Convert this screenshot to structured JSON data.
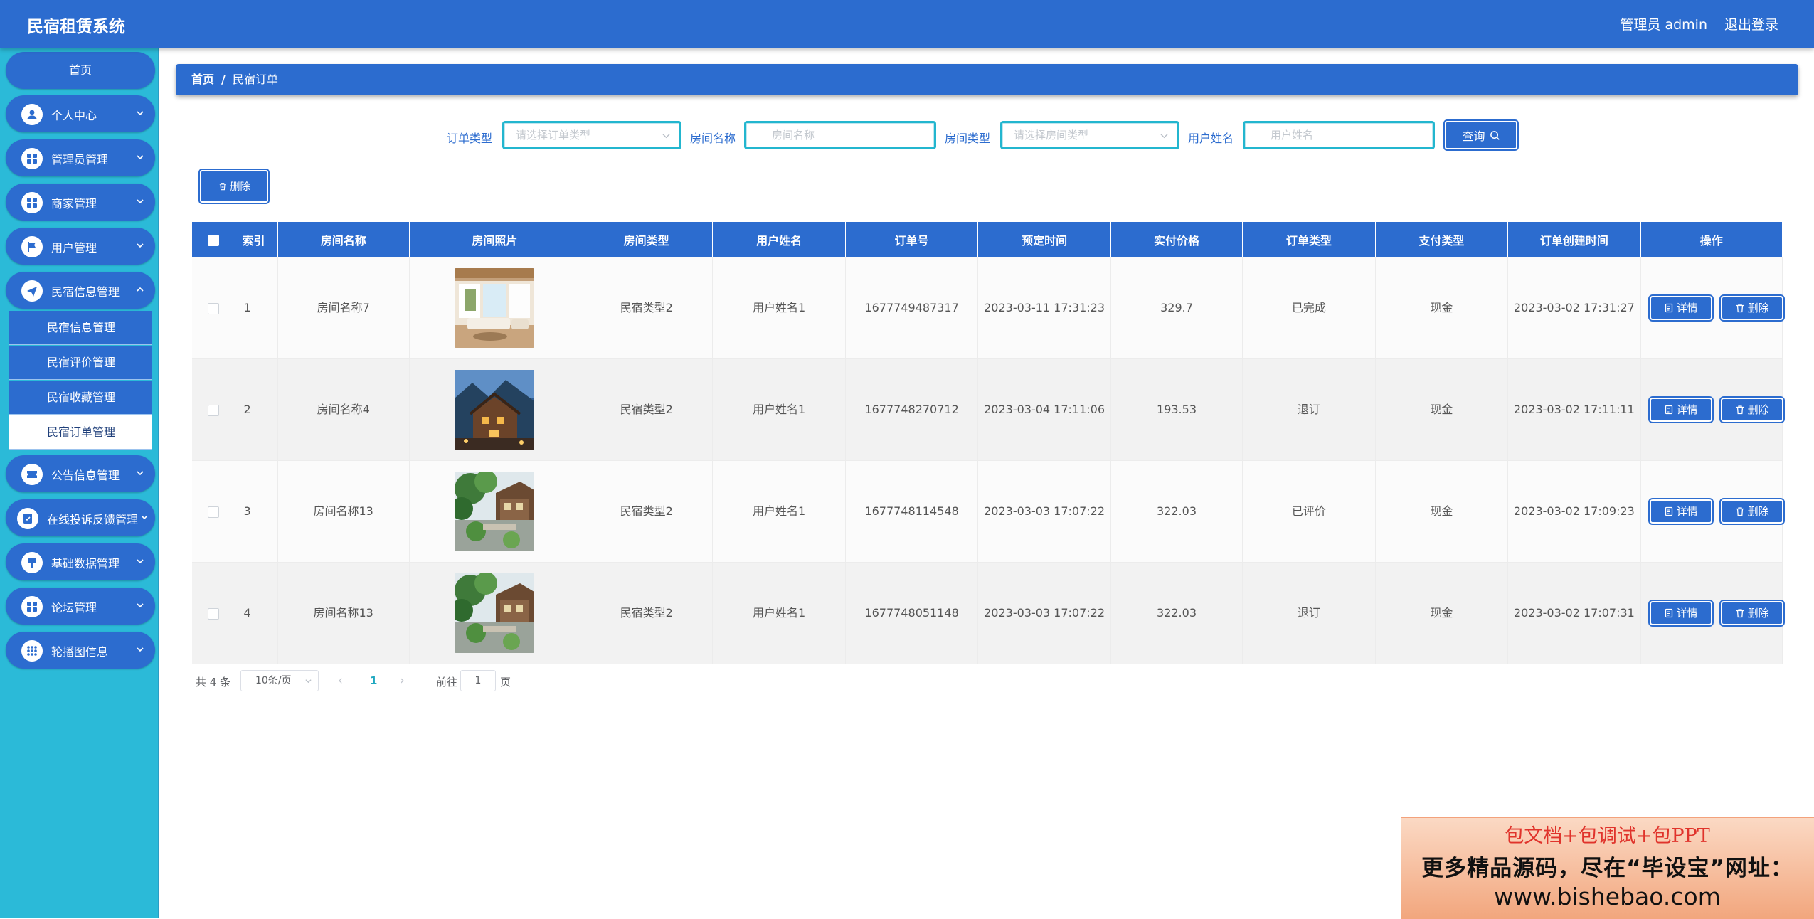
{
  "app": {
    "title": "民宿租赁系统",
    "admin_label": "管理员 admin",
    "logout_label": "退出登录"
  },
  "sidebar": {
    "home": "首页",
    "items": [
      {
        "label": "个人中心",
        "icon": "user-icon"
      },
      {
        "label": "管理员管理",
        "icon": "grid-icon"
      },
      {
        "label": "商家管理",
        "icon": "grid-icon"
      },
      {
        "label": "用户管理",
        "icon": "flag-icon"
      },
      {
        "label": "民宿信息管理",
        "icon": "send-icon",
        "expanded": true
      },
      {
        "label": "公告信息管理",
        "icon": "ticket-icon"
      },
      {
        "label": "在线投诉反馈管理",
        "icon": "checklist-icon"
      },
      {
        "label": "基础数据管理",
        "icon": "sign-icon"
      },
      {
        "label": "论坛管理",
        "icon": "grid-icon"
      },
      {
        "label": "轮播图信息",
        "icon": "dots-grid-icon"
      }
    ],
    "subitems": [
      "民宿信息管理",
      "民宿评价管理",
      "民宿收藏管理",
      "民宿订单管理"
    ],
    "active_subitem": "民宿订单管理",
    "colors": {
      "sidebar_bg": "#2bbad8",
      "item_bg": "#2c6ccf"
    }
  },
  "breadcrumb": {
    "home": "首页",
    "sep": "/",
    "current": "民宿订单"
  },
  "search": {
    "order_type_label": "订单类型",
    "order_type_placeholder": "请选择订单类型",
    "room_name_label": "房间名称",
    "room_name_placeholder": "房间名称",
    "room_type_label": "房间类型",
    "room_type_placeholder": "请选择房间类型",
    "user_name_label": "用户姓名",
    "user_name_placeholder": "用户姓名",
    "query_label": "查询"
  },
  "toolbar": {
    "delete_label": "删除"
  },
  "table": {
    "headers": [
      "索引",
      "房间名称",
      "房间照片",
      "房间类型",
      "用户姓名",
      "订单号",
      "预定时间",
      "实付价格",
      "订单类型",
      "支付类型",
      "订单创建时间",
      "操作"
    ],
    "rows": [
      {
        "index": "1",
        "room_name": "房间名称7",
        "photo": "bright-living-room-photo",
        "room_type": "民宿类型2",
        "user_name": "用户姓名1",
        "order_no": "1677749487317",
        "booking_time": "2023-03-11 17:31:23",
        "price": "329.7",
        "order_type": "已完成",
        "pay_type": "现金",
        "created_at": "2023-03-02 17:31:27"
      },
      {
        "index": "2",
        "room_name": "房间名称4",
        "photo": "mountain-lodge-dusk-photo",
        "room_type": "民宿类型2",
        "user_name": "用户姓名1",
        "order_no": "1677748270712",
        "booking_time": "2023-03-04 17:11:06",
        "price": "193.53",
        "order_type": "退订",
        "pay_type": "现金",
        "created_at": "2023-03-02 17:11:11"
      },
      {
        "index": "3",
        "room_name": "房间名称13",
        "photo": "garden-cabin-photo",
        "room_type": "民宿类型2",
        "user_name": "用户姓名1",
        "order_no": "1677748114548",
        "booking_time": "2023-03-03 17:07:22",
        "price": "322.03",
        "order_type": "已评价",
        "pay_type": "现金",
        "created_at": "2023-03-02 17:09:23"
      },
      {
        "index": "4",
        "room_name": "房间名称13",
        "photo": "garden-cabin-photo",
        "room_type": "民宿类型2",
        "user_name": "用户姓名1",
        "order_no": "1677748051148",
        "booking_time": "2023-03-03 17:07:22",
        "price": "322.03",
        "order_type": "退订",
        "pay_type": "现金",
        "created_at": "2023-03-02 17:07:31"
      }
    ],
    "detail_label": "详情",
    "delete_label": "删除"
  },
  "pagination": {
    "total": "共 4 条",
    "page_size": "10条/页",
    "current_page": "1",
    "goto_prefix": "前往",
    "goto_value": "1",
    "goto_suffix": "页"
  },
  "watermark": {
    "line1": "包文档+包调试+包PPT",
    "line2": "更多精品源码，尽在“毕设宝”网址：",
    "line3": "www.bishebao.com"
  }
}
